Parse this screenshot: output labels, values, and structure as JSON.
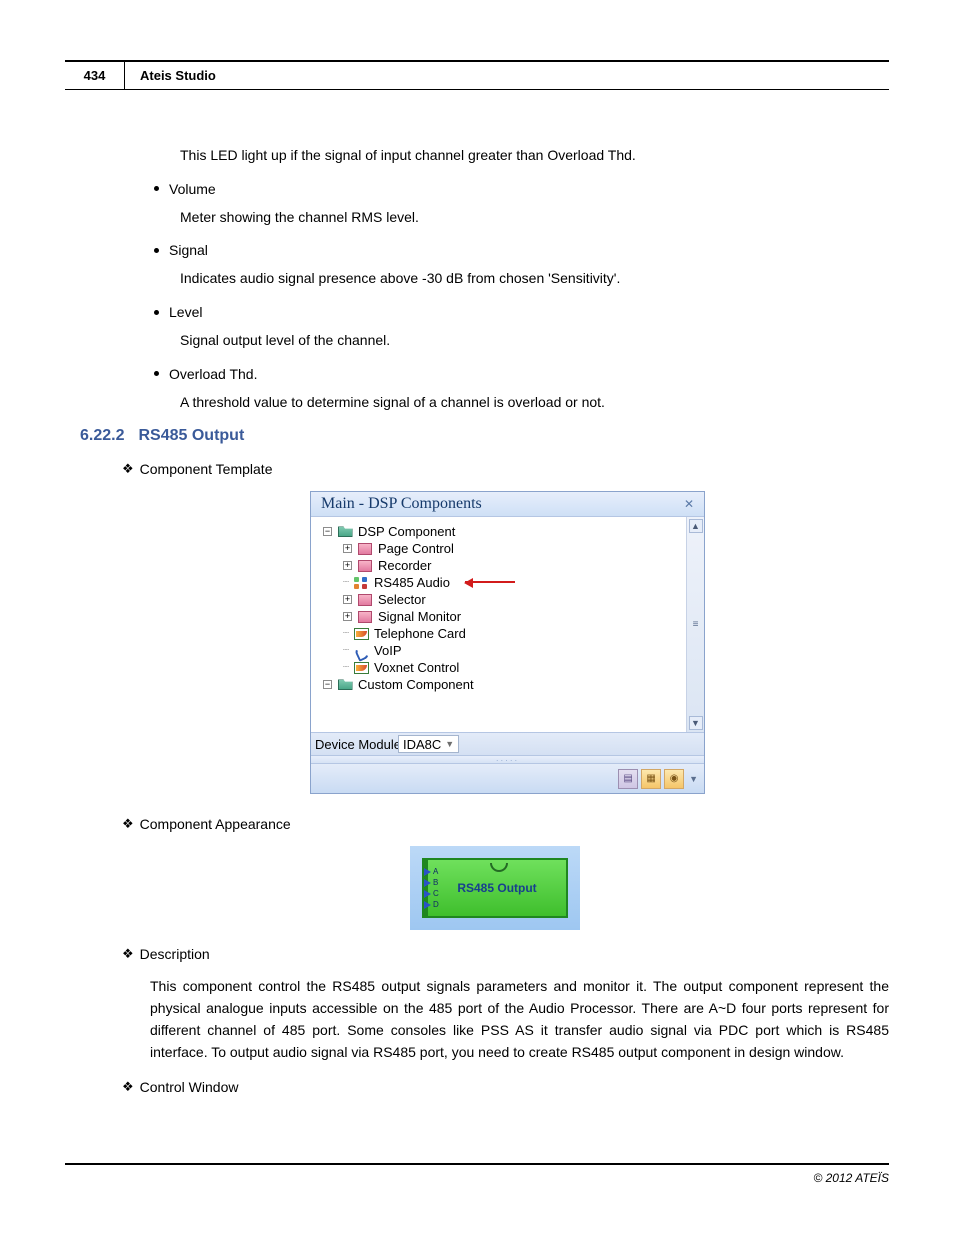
{
  "header": {
    "page": "434",
    "title": "Ateis Studio"
  },
  "intro": {
    "led_text": "This LED light up if the signal of input channel greater than Overload Thd.",
    "bullets": [
      {
        "label": "Volume",
        "desc": "Meter showing the channel RMS level."
      },
      {
        "label": "Signal",
        "desc": "Indicates audio signal presence above -30 dB from chosen 'Sensitivity'."
      },
      {
        "label": "Level",
        "desc": "Signal output level of the channel."
      },
      {
        "label": "Overload Thd.",
        "desc": "A threshold value to determine signal of a channel is overload or not."
      }
    ]
  },
  "section": {
    "num": "6.22.2",
    "title": "RS485 Output"
  },
  "subs": {
    "template": "Component Template",
    "appearance": "Component Appearance",
    "description": "Description",
    "control": "Control Window"
  },
  "panel": {
    "title": "Main - DSP Components",
    "tree": {
      "root1": "DSP Component",
      "items": [
        "Page Control",
        "Recorder",
        "RS485 Audio",
        "Selector",
        "Signal Monitor",
        "Telephone Card",
        "VoIP",
        "Voxnet Control"
      ],
      "root2": "Custom Component"
    },
    "device_label": "Device Module",
    "device_value": "IDA8C"
  },
  "component": {
    "label": "RS485 Output",
    "ports": [
      "A",
      "B",
      "C",
      "D"
    ]
  },
  "description_text": "This component control the RS485 output signals parameters and monitor it. The output component represent the physical analogue inputs accessible on the 485 port of the Audio Processor. There are A~D four ports represent for different channel of 485 port. Some consoles like PSS AS it transfer audio signal via PDC port which is RS485 interface. To output audio signal via RS485 port, you need to create RS485 output component in design window.",
  "footer": "© 2012 ATEÏS"
}
